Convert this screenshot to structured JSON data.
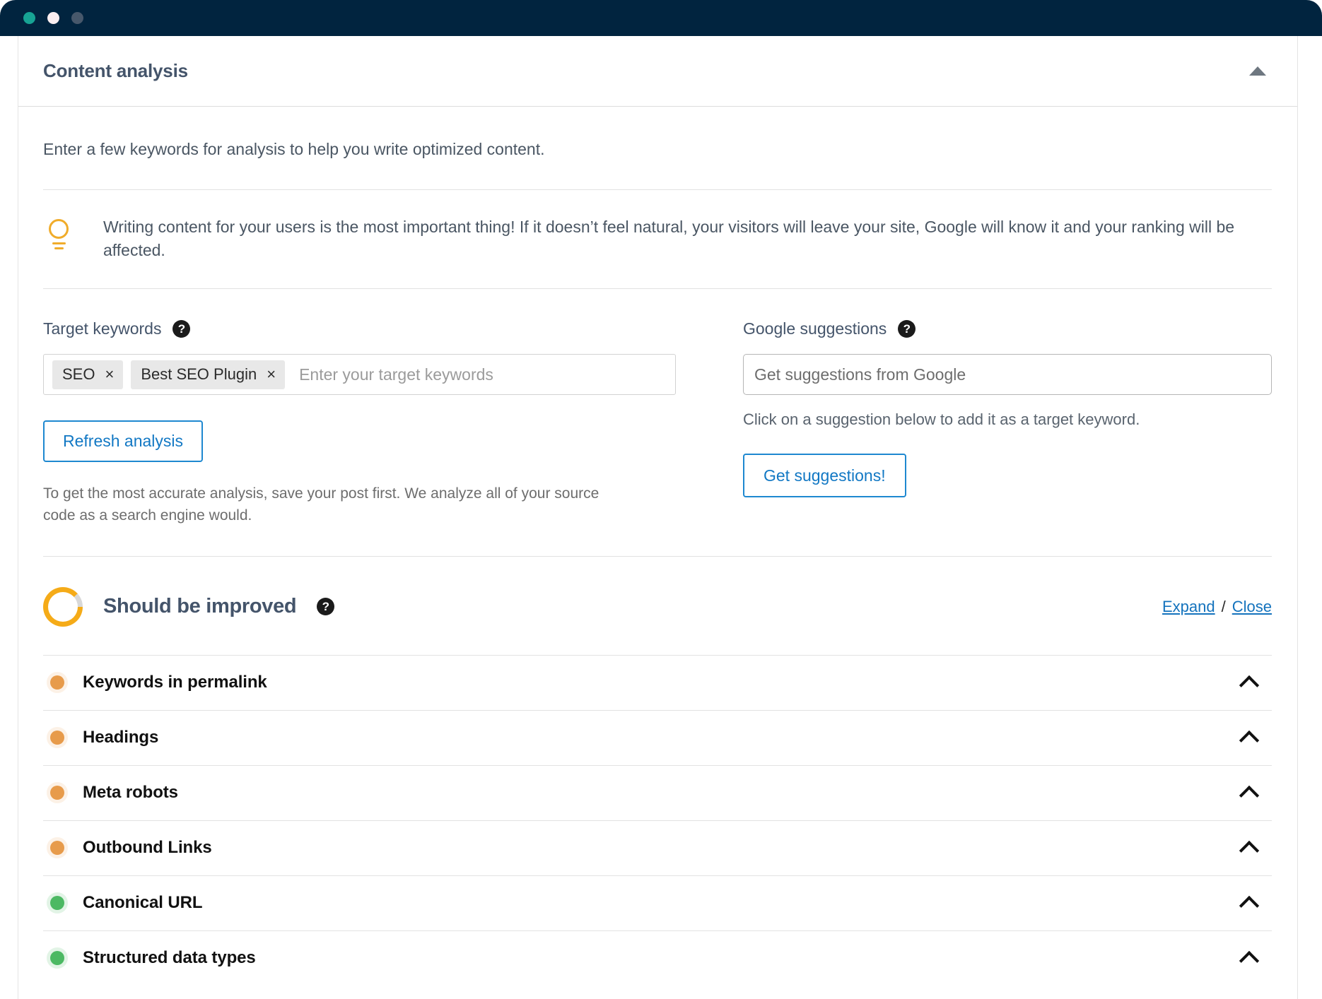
{
  "titlebar": {
    "dots": [
      {
        "name": "window-dot-green",
        "color": "#17a394"
      },
      {
        "name": "window-dot-white",
        "color": "#fbeef0"
      },
      {
        "name": "window-dot-gray",
        "color": "#47586b"
      }
    ]
  },
  "panel": {
    "title": "Content analysis",
    "collapse_icon": "triangle-up-icon"
  },
  "intro": "Enter a few keywords for analysis to help you write optimized content.",
  "tip": {
    "icon": "lightbulb-icon",
    "text": "Writing content for your users is the most important thing! If it doesn’t feel natural, your visitors will leave your site, Google will know it and your ranking will be affected."
  },
  "target_keywords": {
    "label": "Target keywords",
    "help_icon": "question-mark-icon",
    "tags": [
      {
        "label": "SEO",
        "remove": "×"
      },
      {
        "label": "Best SEO Plugin",
        "remove": "×"
      }
    ],
    "placeholder": "Enter your target keywords",
    "refresh_label": "Refresh analysis",
    "note": "To get the most accurate analysis, save your post first. We analyze all of your source code as a search engine would."
  },
  "google_suggestions": {
    "label": "Google suggestions",
    "help_icon": "question-mark-icon",
    "input_value": "Get suggestions from Google",
    "sub_note": "Click on a suggestion below to add it as a target keyword.",
    "button_label": "Get suggestions!"
  },
  "score": {
    "title": "Should be improved",
    "help_icon": "question-mark-icon",
    "ring_color": "#f5ab18",
    "ring_track_color": "#d8d8d8",
    "expand_label": "Expand",
    "separator": "/",
    "close_label": "Close"
  },
  "checks": [
    {
      "label": "Keywords in permalink",
      "status": "orange",
      "toggle_icon": "chevron-up-icon"
    },
    {
      "label": "Headings",
      "status": "orange",
      "toggle_icon": "chevron-up-icon"
    },
    {
      "label": "Meta robots",
      "status": "orange",
      "toggle_icon": "chevron-up-icon"
    },
    {
      "label": "Outbound Links",
      "status": "orange",
      "toggle_icon": "chevron-up-icon"
    },
    {
      "label": "Canonical URL",
      "status": "green",
      "toggle_icon": "chevron-up-icon"
    },
    {
      "label": "Structured data types",
      "status": "green",
      "toggle_icon": "chevron-up-icon"
    }
  ],
  "colors": {
    "titlebar_bg": "#01243f",
    "link_blue": "#1473bd",
    "button_blue": "#1e88d0",
    "status_orange": "#e79b4b",
    "status_green": "#4cb963",
    "tip_amber": "#f0ac2b"
  }
}
